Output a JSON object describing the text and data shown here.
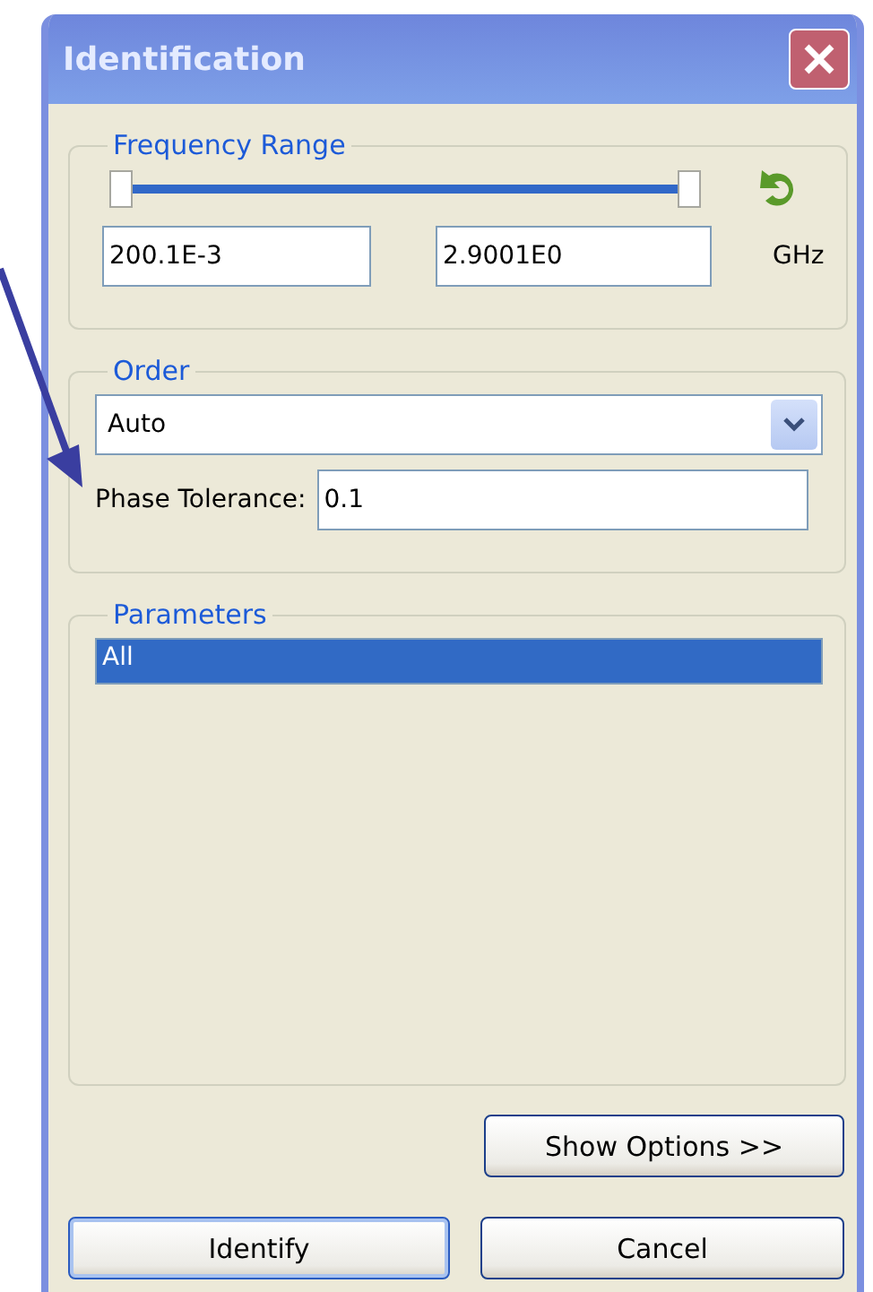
{
  "window": {
    "title": "Identification"
  },
  "frequency_range": {
    "title": "Frequency Range",
    "thumbs": [
      {
        "level": 0
      },
      {
        "level": 1
      }
    ],
    "start": "200.1E-3",
    "stop": "2.9001E0",
    "unit": "GHz"
  },
  "order": {
    "title": "Order",
    "value": "Auto",
    "phase_tolerance_label": "Phase Tolerance:",
    "phase_tolerance": "0.1"
  },
  "parameters": {
    "title": "Parameters",
    "items": [
      {
        "label": "All",
        "selected": true
      }
    ]
  },
  "buttons": {
    "show_options": "Show Options >>",
    "identify": "Identify",
    "cancel": "Cancel"
  }
}
